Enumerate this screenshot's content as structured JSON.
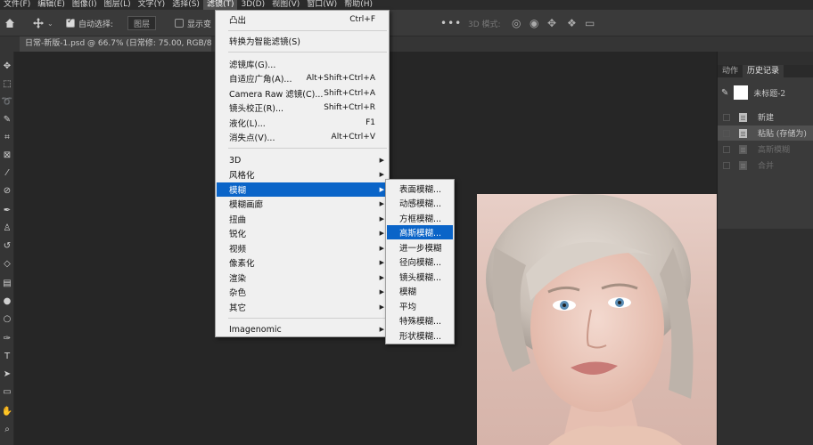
{
  "menubar": {
    "items": [
      "文件(F)",
      "编辑(E)",
      "图像(I)",
      "图层(L)",
      "文字(Y)",
      "选择(S)",
      "滤镜(T)",
      "3D(D)",
      "视图(V)",
      "窗口(W)",
      "帮助(H)"
    ],
    "active_index": 6
  },
  "options": {
    "auto_select_label": "自动选择:",
    "layer_select_value": "图层",
    "show_transform_label": "显示变",
    "mode_3d_label": "3D 模式:"
  },
  "document": {
    "tab_title": "日常-新版-1.psd @ 66.7% (日常修: 75.00, RGB/8#)"
  },
  "filter_menu": {
    "items": [
      {
        "label": "凸出",
        "shortcut": "Ctrl+F"
      },
      {
        "label": "转换为智能滤镜(S)",
        "shortcut": ""
      },
      {
        "label": "滤镜库(G)...",
        "shortcut": ""
      },
      {
        "label": "自适应广角(A)...",
        "shortcut": "Alt+Shift+Ctrl+A"
      },
      {
        "label": "Camera Raw 滤镜(C)...",
        "shortcut": "Shift+Ctrl+A"
      },
      {
        "label": "镜头校正(R)...",
        "shortcut": "Shift+Ctrl+R"
      },
      {
        "label": "液化(L)...",
        "shortcut": "F1"
      },
      {
        "label": "消失点(V)...",
        "shortcut": "Alt+Ctrl+V"
      },
      {
        "label": "3D",
        "shortcut": ""
      },
      {
        "label": "风格化",
        "shortcut": ""
      },
      {
        "label": "模糊",
        "shortcut": ""
      },
      {
        "label": "模糊画廊",
        "shortcut": ""
      },
      {
        "label": "扭曲",
        "shortcut": ""
      },
      {
        "label": "锐化",
        "shortcut": ""
      },
      {
        "label": "视频",
        "shortcut": ""
      },
      {
        "label": "像素化",
        "shortcut": ""
      },
      {
        "label": "渲染",
        "shortcut": ""
      },
      {
        "label": "杂色",
        "shortcut": ""
      },
      {
        "label": "其它",
        "shortcut": ""
      },
      {
        "label": "Imagenomic",
        "shortcut": ""
      }
    ]
  },
  "blur_submenu": {
    "items": [
      "表面模糊...",
      "动感模糊...",
      "方框模糊...",
      "高斯模糊...",
      "进一步模糊",
      "径向模糊...",
      "镜头模糊...",
      "模糊",
      "平均",
      "特殊模糊...",
      "形状模糊..."
    ],
    "highlighted_index": 3
  },
  "history_panel": {
    "tabs": [
      "动作",
      "历史记录"
    ],
    "snapshot_label": "未标题-2",
    "steps": [
      {
        "label": "新建"
      },
      {
        "label": "粘贴 (存储为)"
      },
      {
        "label": "高斯模糊"
      },
      {
        "label": "合并"
      }
    ]
  },
  "colors": {
    "accent": "#0a64c8",
    "menu_bg": "#f0f0f0",
    "app_bg": "#262626"
  }
}
